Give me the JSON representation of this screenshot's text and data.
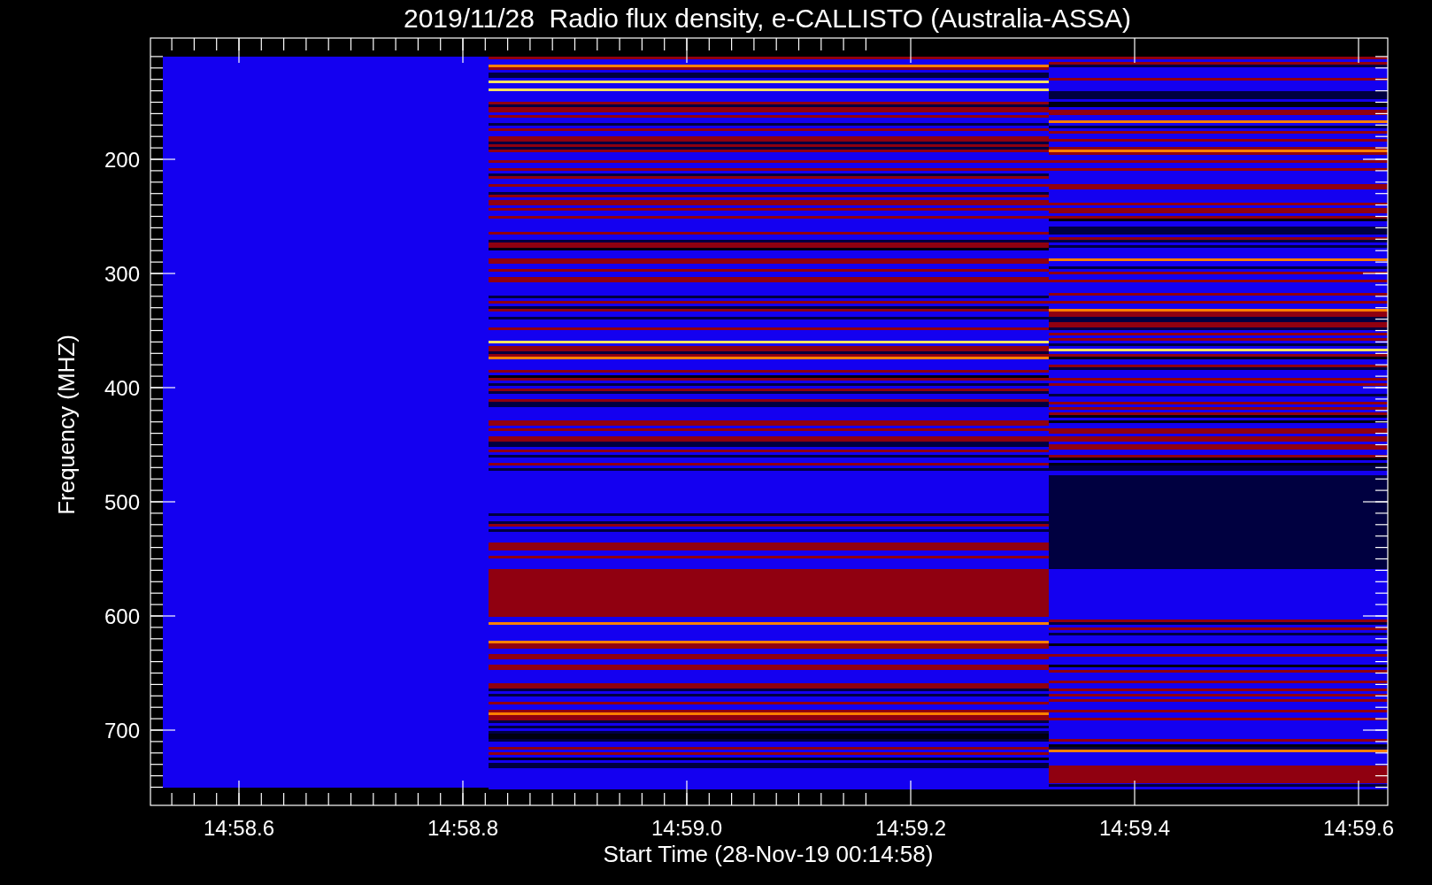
{
  "title": "2019/11/28  Radio flux density, e-CALLISTO (Australia-ASSA)",
  "y_axis": {
    "label": "Frequency (MHZ)",
    "ticks": [
      "200",
      "300",
      "400",
      "500",
      "600",
      "700"
    ]
  },
  "x_axis": {
    "label": "Start Time (28-Nov-19 00:14:58)",
    "ticks": [
      "14:58.6",
      "14:58.8",
      "14:59.0",
      "14:59.2",
      "14:59.4",
      "14:59.6"
    ]
  }
}
